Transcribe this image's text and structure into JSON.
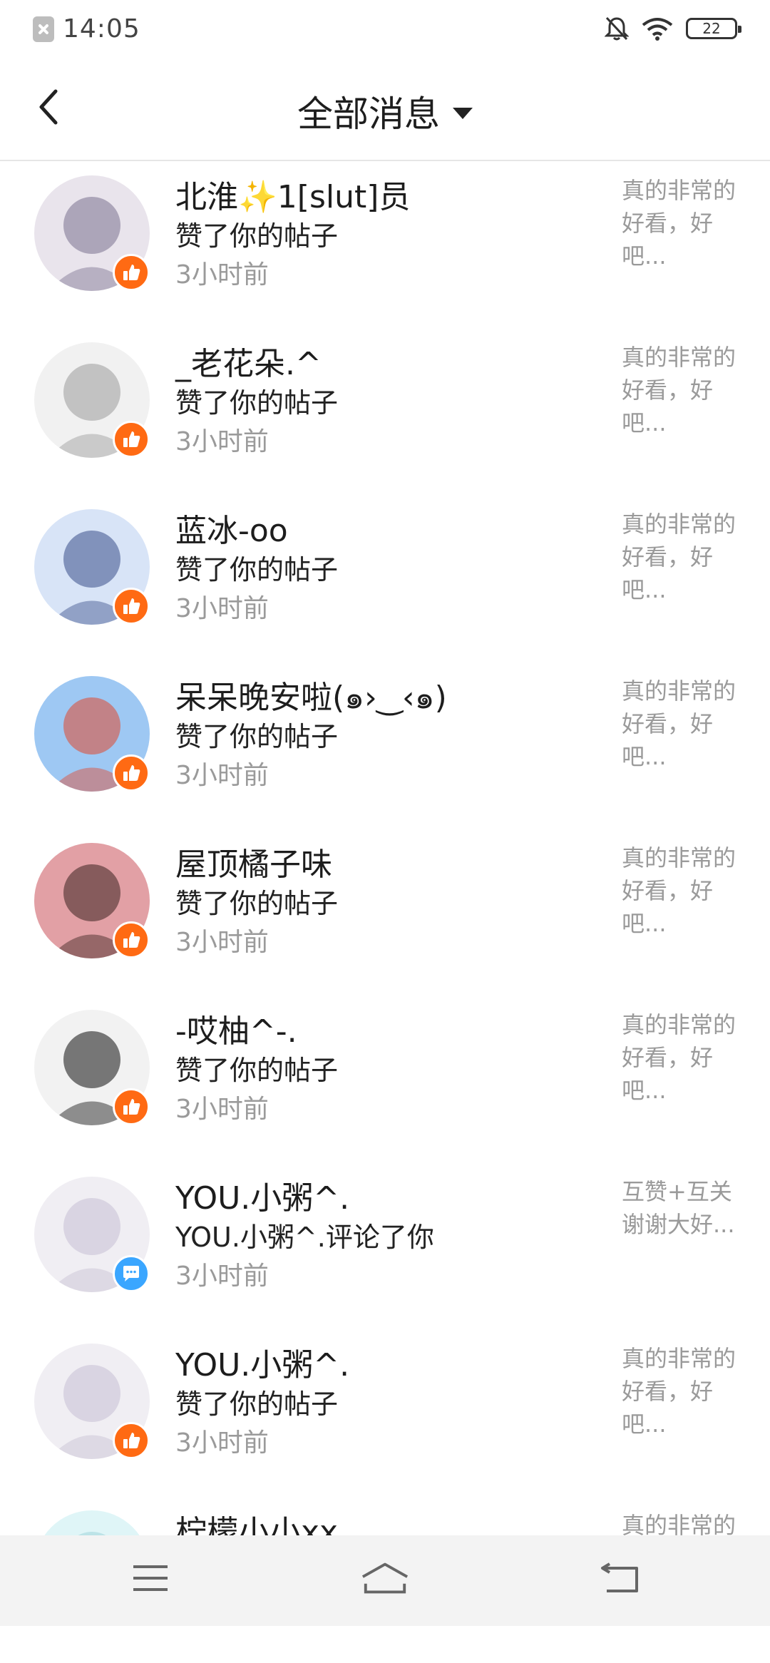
{
  "status_bar": {
    "time": "14:05",
    "battery": "22"
  },
  "header": {
    "title": "全部消息"
  },
  "items": [
    {
      "name": "北淮✨1[slut]员",
      "action": "赞了你的帖子",
      "time": "3小时前",
      "preview": "真的非常的好看，好吧...",
      "badge": "like",
      "avatar_colors": [
        "#e9e4ec",
        "#7a7190"
      ]
    },
    {
      "name": "_老花朵.^",
      "action": "赞了你的帖子",
      "time": "3小时前",
      "preview": "真的非常的好看，好吧...",
      "badge": "like",
      "avatar_colors": [
        "#f1f1f1",
        "#9b9b9b"
      ]
    },
    {
      "name": "蓝冰-oo",
      "action": "赞了你的帖子",
      "time": "3小时前",
      "preview": "真的非常的好看，好吧...",
      "badge": "like",
      "avatar_colors": [
        "#d8e4f7",
        "#3b4f8a"
      ]
    },
    {
      "name": "呆呆晚安啦(๑›‿‹๑)",
      "action": "赞了你的帖子",
      "time": "3小时前",
      "preview": "真的非常的好看，好吧...",
      "badge": "like",
      "avatar_colors": [
        "#9ec8f3",
        "#e0482e"
      ]
    },
    {
      "name": "屋顶橘子味",
      "action": "赞了你的帖子",
      "time": "3小时前",
      "preview": "真的非常的好看，好吧...",
      "badge": "like",
      "avatar_colors": [
        "#e2a0a5",
        "#3a2220"
      ]
    },
    {
      "name": "-哎柚^-.",
      "action": "赞了你的帖子",
      "time": "3小时前",
      "preview": "真的非常的好看，好吧...",
      "badge": "like",
      "avatar_colors": [
        "#f2f2f2",
        "#111111"
      ]
    },
    {
      "name": "YOU.小粥^.",
      "action": "YOU.小粥^.评论了你",
      "time": "3小时前",
      "preview": "互赞+互关谢谢大好...",
      "badge": "comment",
      "avatar_colors": [
        "#f0eef3",
        "#c6bfd3"
      ]
    },
    {
      "name": "YOU.小粥^.",
      "action": "赞了你的帖子",
      "time": "3小时前",
      "preview": "真的非常的好看，好吧...",
      "badge": "like",
      "avatar_colors": [
        "#f0eef3",
        "#c6bfd3"
      ]
    },
    {
      "name": "柠檬小小xx",
      "action": "",
      "time": "",
      "preview": "真的非常的",
      "badge": "",
      "avatar_colors": [
        "#dff5f7",
        "#9fd4da"
      ]
    }
  ]
}
